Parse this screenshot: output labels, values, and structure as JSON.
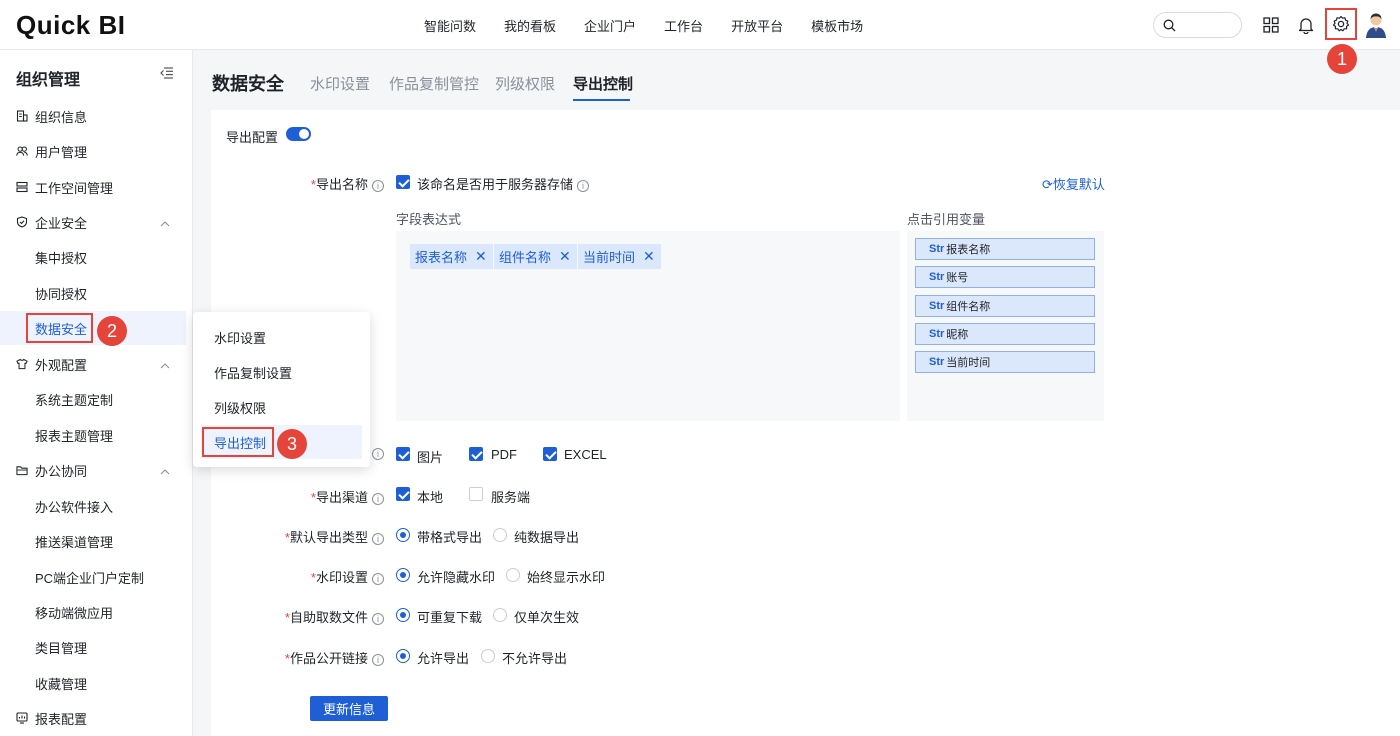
{
  "app": {
    "logo": "Quick BI"
  },
  "topnav": [
    "智能问数",
    "我的看板",
    "企业门户",
    "工作台",
    "开放平台",
    "模板市场"
  ],
  "steps": [
    "1",
    "2",
    "3"
  ],
  "sidebar": {
    "title": "组织管理",
    "items": [
      {
        "label": "组织信息",
        "icon": "building-icon"
      },
      {
        "label": "用户管理",
        "icon": "users-icon"
      },
      {
        "label": "工作空间管理",
        "icon": "database-icon"
      },
      {
        "label": "企业安全",
        "icon": "shield-icon",
        "expanded": true
      },
      {
        "label": "集中授权"
      },
      {
        "label": "协同授权"
      },
      {
        "label": "数据安全",
        "active": true
      },
      {
        "label": "外观配置",
        "icon": "shirt-icon",
        "expanded": true
      },
      {
        "label": "系统主题定制"
      },
      {
        "label": "报表主题管理"
      },
      {
        "label": "办公协同",
        "icon": "folder-icon",
        "expanded": true
      },
      {
        "label": "办公软件接入"
      },
      {
        "label": "推送渠道管理"
      },
      {
        "label": "PC端企业门户定制"
      },
      {
        "label": "移动端微应用"
      },
      {
        "label": "类目管理"
      },
      {
        "label": "收藏管理"
      },
      {
        "label": "报表配置",
        "icon": "report-icon"
      }
    ]
  },
  "popup": {
    "items": [
      "水印设置",
      "作品复制设置",
      "列级权限",
      "导出控制"
    ],
    "active_index": 3
  },
  "main": {
    "title": "数据安全",
    "tabs": [
      "水印设置",
      "作品复制管控",
      "列级权限",
      "导出控制"
    ],
    "active_tab": "导出控制"
  },
  "form": {
    "export_config_label": "导出配置",
    "export_config_on": true,
    "export_name": {
      "label": "导出名称",
      "checkbox_label": "该命名是否用于服务器存储",
      "checked": true,
      "restore_label": "恢复默认",
      "expr_title": "字段表达式",
      "chips": [
        "报表名称",
        "组件名称",
        "当前时间"
      ],
      "var_title": "点击引用变量",
      "var_prefix": "Str",
      "variables": [
        "报表名称",
        "账号",
        "组件名称",
        "昵称",
        "当前时间"
      ]
    },
    "export_format": {
      "options": [
        {
          "label": "图片",
          "checked": true
        },
        {
          "label": "PDF",
          "checked": true
        },
        {
          "label": "EXCEL",
          "checked": true
        }
      ]
    },
    "export_channel": {
      "label": "导出渠道",
      "options": [
        {
          "label": "本地",
          "checked": true
        },
        {
          "label": "服务端",
          "checked": false
        }
      ]
    },
    "default_export_type": {
      "label": "默认导出类型",
      "options": [
        "带格式导出",
        "纯数据导出"
      ],
      "selected": 0
    },
    "watermark": {
      "label": "水印设置",
      "options": [
        "允许隐藏水印",
        "始终显示水印"
      ],
      "selected": 0
    },
    "self_fetch": {
      "label": "自助取数文件",
      "options": [
        "可重复下载",
        "仅单次生效"
      ],
      "selected": 0
    },
    "public_link": {
      "label": "作品公开链接",
      "options": [
        "允许导出",
        "不允许导出"
      ],
      "selected": 0
    },
    "submit_label": "更新信息"
  }
}
